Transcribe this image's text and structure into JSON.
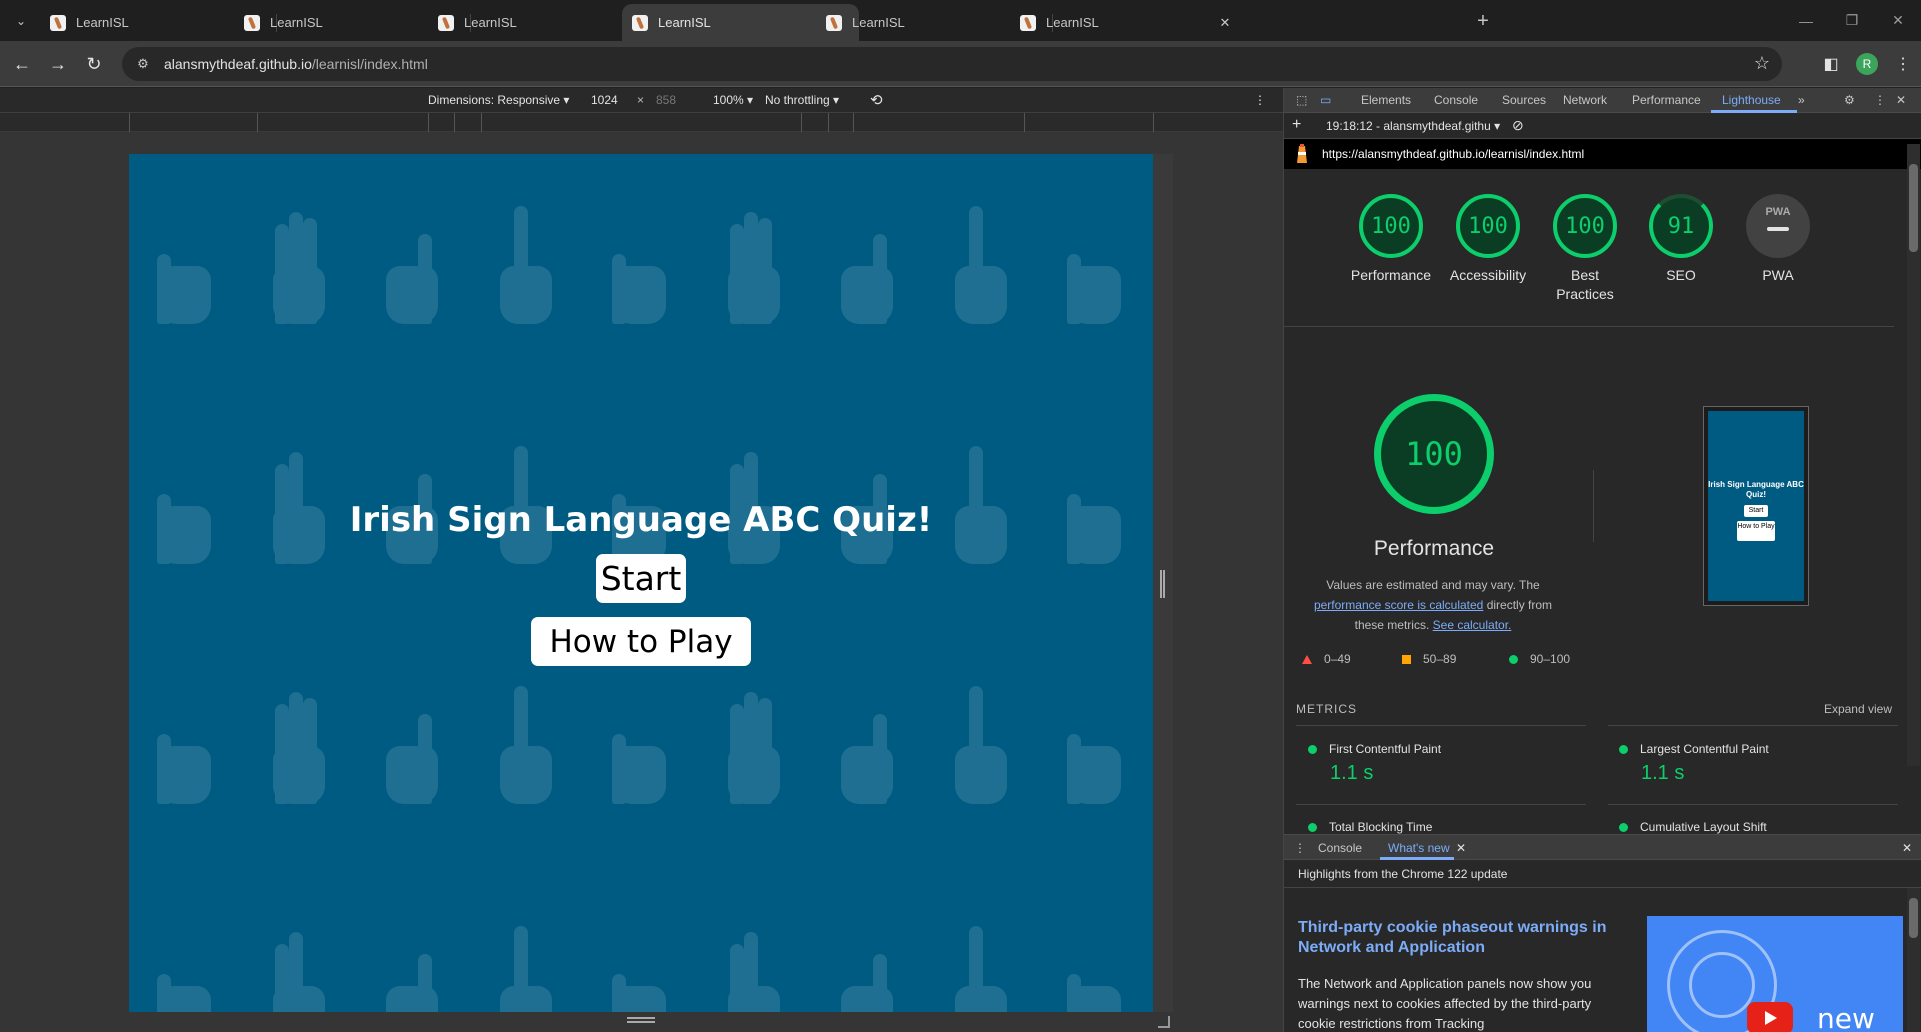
{
  "tabs": [
    {
      "title": "LearnISL"
    },
    {
      "title": "LearnISL"
    },
    {
      "title": "LearnISL"
    },
    {
      "title": "LearnISL"
    },
    {
      "title": "LearnISL"
    },
    {
      "title": "LearnISL"
    }
  ],
  "address": {
    "host": "alansmythdeaf.github.io",
    "path": "/learnisl/index.html"
  },
  "devbar": {
    "dimensions": "Dimensions: Responsive",
    "width": "1024",
    "height": "858",
    "zoom": "100%",
    "throttling": "No throttling"
  },
  "page": {
    "title": "Irish Sign Language ABC Quiz!",
    "start_label": "Start",
    "howto_label": "How to Play",
    "background_color": "#005b82"
  },
  "devtools": {
    "tabs": [
      "Elements",
      "Console",
      "Sources",
      "Network",
      "Performance",
      "Lighthouse"
    ],
    "selected_tab": "Lighthouse",
    "report_time": "19:18:12 - alansmythdeaf.githu",
    "report_url": "https://alansmythdeaf.github.io/learnisl/index.html",
    "scores": [
      {
        "label": "Performance",
        "value": "100"
      },
      {
        "label": "Accessibility",
        "value": "100"
      },
      {
        "label": "Best Practices",
        "value": "100"
      },
      {
        "label": "SEO",
        "value": "91"
      }
    ],
    "pwa_label": "PWA",
    "pwa_badge": "PWA",
    "big_score": "100",
    "big_label": "Performance",
    "note_1": "Values are estimated and may vary. The",
    "note_link_1": "performance score is calculated",
    "note_2": "directly from these metrics.",
    "note_link_2": "See calculator.",
    "legend": [
      "0–49",
      "50–89",
      "90–100"
    ],
    "thumb_title": "Irish Sign Language ABC Quiz!",
    "thumb_start": "Start",
    "thumb_howto": "How to Play",
    "metrics_heading": "METRICS",
    "expand_view": "Expand view",
    "metrics": [
      {
        "name": "First Contentful Paint",
        "value": "1.1 s"
      },
      {
        "name": "Largest Contentful Paint",
        "value": "1.1 s"
      },
      {
        "name": "Total Blocking Time",
        "value": ""
      },
      {
        "name": "Cumulative Layout Shift",
        "value": ""
      }
    ],
    "drawer_tabs": [
      "Console",
      "What's new"
    ],
    "highlights": "Highlights from the Chrome 122 update",
    "whatsnew_title": "Third-party cookie phaseout warnings in Network and Application",
    "whatsnew_body": "The Network and Application panels now show you warnings next to cookies affected by the third-party cookie restrictions from Tracking",
    "whatsnew_image_text": "new"
  },
  "colors": {
    "accent": "#7cacf8",
    "score_green": "#0cce6b",
    "fail_red": "#ff4e42",
    "average_orange": "#ffa400"
  }
}
